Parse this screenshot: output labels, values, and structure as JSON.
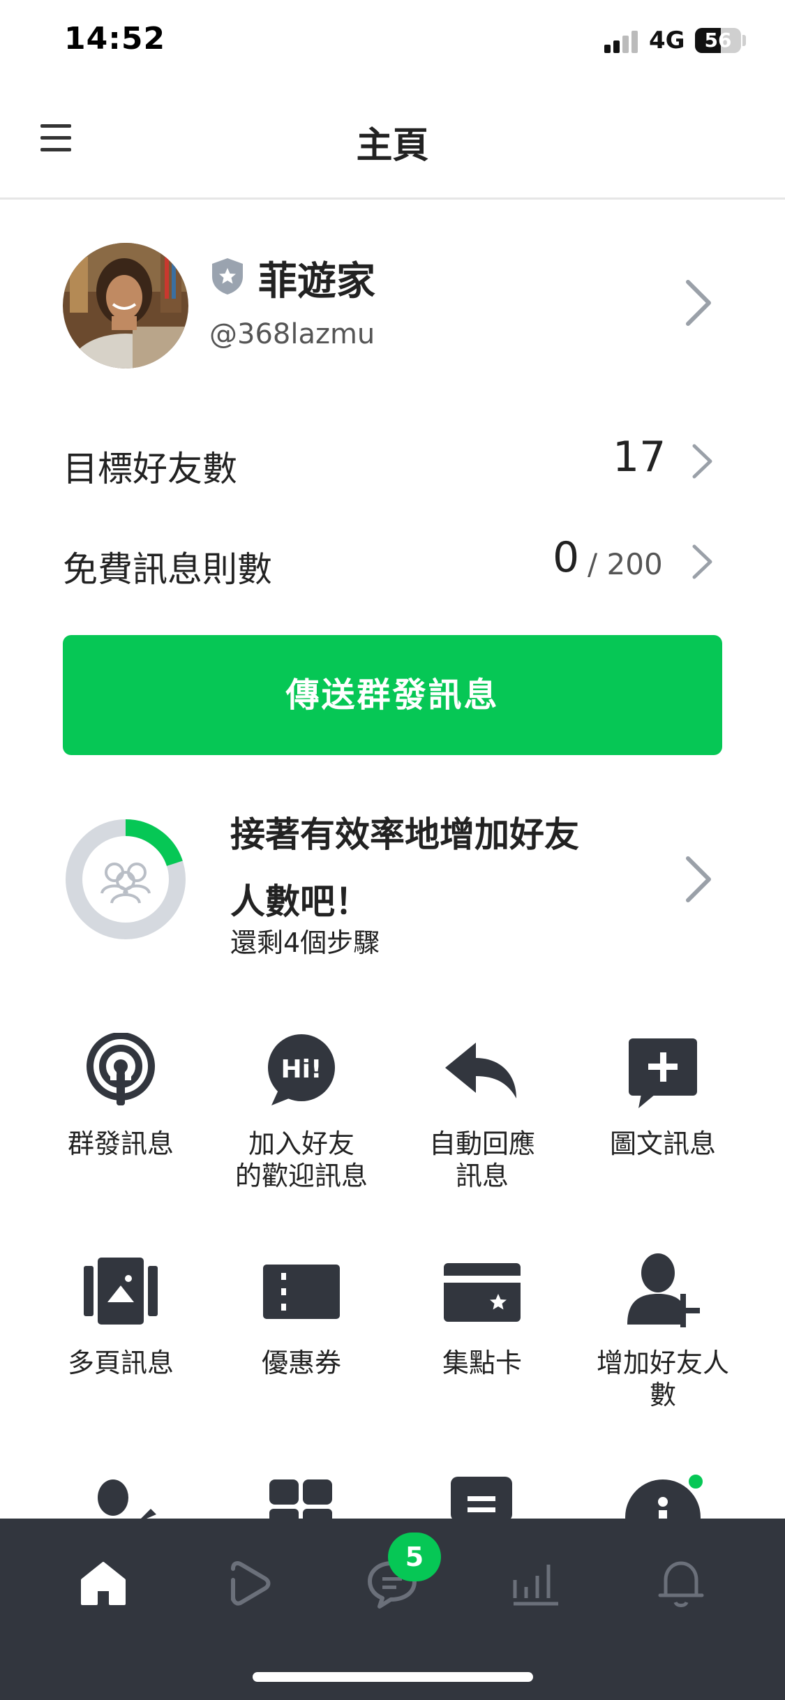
{
  "status_bar": {
    "time": "14:52",
    "network": "4G",
    "battery": "56",
    "battery_level": 0.56
  },
  "header": {
    "title": "主頁"
  },
  "profile": {
    "name": "菲遊家",
    "account_id": "@368lazmu"
  },
  "stats": {
    "target_friends": {
      "label": "目標好友數",
      "value": "17"
    },
    "free_messages": {
      "label": "免費訊息則數",
      "value": "0",
      "total": "/ 200"
    }
  },
  "broadcast_button": {
    "label": "傳送群發訊息"
  },
  "growth": {
    "title_line1": "接著有效率地增加好友",
    "title_line2": "人數吧！",
    "steps": "還剩4個步驟",
    "progress": 0.2
  },
  "features": [
    {
      "line1": "群發訊息",
      "line2": "",
      "icon": "broadcast-icon"
    },
    {
      "line1": "加入好友",
      "line2": "的歡迎訊息",
      "icon": "hi-bubble-icon"
    },
    {
      "line1": "自動回應",
      "line2": "訊息",
      "icon": "reply-arrow-icon"
    },
    {
      "line1": "圖文訊息",
      "line2": "",
      "icon": "rich-message-icon"
    },
    {
      "line1": "多頁訊息",
      "line2": "",
      "icon": "card-pages-icon"
    },
    {
      "line1": "優惠券",
      "line2": "",
      "icon": "coupon-icon"
    },
    {
      "line1": "集點卡",
      "line2": "",
      "icon": "point-card-icon"
    },
    {
      "line1": "增加好友人",
      "line2": "數",
      "icon": "add-friend-icon"
    }
  ],
  "bottom_nav": {
    "items": [
      "home-icon",
      "voom-icon",
      "chat-icon",
      "insights-icon",
      "notifications-icon"
    ],
    "chat_badge": "5"
  },
  "colors": {
    "brand_green": "#06c755",
    "nav_background": "#32363e",
    "icon_dark": "#32363e"
  }
}
